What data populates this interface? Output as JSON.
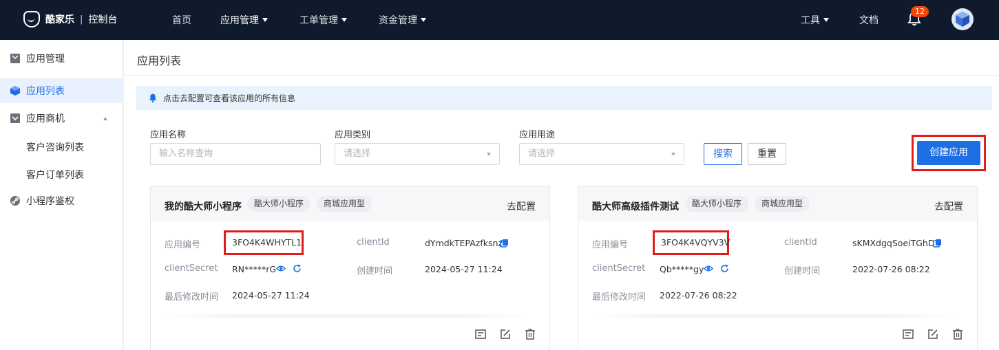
{
  "brand": {
    "name": "酷家乐",
    "separator": "|",
    "console": "控制台"
  },
  "nav": {
    "items": [
      {
        "label": "首页"
      },
      {
        "label": "应用管理"
      },
      {
        "label": "工单管理"
      },
      {
        "label": "资金管理"
      }
    ],
    "tools": "工具",
    "docs": "文档",
    "notification_count": "12"
  },
  "sidebar": {
    "items": [
      {
        "label": "应用管理"
      },
      {
        "label": "应用列表"
      },
      {
        "label": "应用商机"
      },
      {
        "label": "客户咨询列表"
      },
      {
        "label": "客户订单列表"
      },
      {
        "label": "小程序鉴权"
      }
    ]
  },
  "page": {
    "title": "应用列表",
    "notice": "点击去配置可查看该应用的所有信息"
  },
  "filters": {
    "name": {
      "label": "应用名称",
      "placeholder": "输入名称查询"
    },
    "type": {
      "label": "应用类别",
      "placeholder": "请选择"
    },
    "usage": {
      "label": "应用用途",
      "placeholder": "请选择"
    },
    "search_label": "搜索",
    "reset_label": "重置",
    "create_label": "创建应用"
  },
  "cards": [
    {
      "name": "我的酷大师小程序",
      "tags": [
        "酷大师小程序",
        "商城应用型"
      ],
      "config_label": "去配置",
      "app_id_key": "应用编号",
      "app_id": "3FO4K4WHYTL1",
      "client_id_key": "clientId",
      "client_id": "dYmdkTEPAzfksnz",
      "secret_key": "clientSecret",
      "secret": "RN*****rG",
      "created_key": "创建时间",
      "created": "2024-05-27 11:24",
      "modified_key": "最后修改时间",
      "modified": "2024-05-27 11:24"
    },
    {
      "name": "酷大师高级插件测试",
      "tags": [
        "酷大师小程序",
        "商城应用型"
      ],
      "config_label": "去配置",
      "app_id_key": "应用编号",
      "app_id": "3FO4K4VQYV3V",
      "client_id_key": "clientId",
      "client_id": "sKMXdgqSoeiTGhD",
      "secret_key": "clientSecret",
      "secret": "Qb*****gy",
      "created_key": "创建时间",
      "created": "2022-07-26 08:22",
      "modified_key": "最后修改时间",
      "modified": "2022-07-26 08:22"
    }
  ],
  "colors": {
    "topbar": "#0f1b2d",
    "primary": "#1e6fe6",
    "highlight_red": "#e21b1b",
    "badge": "#f5460b"
  }
}
